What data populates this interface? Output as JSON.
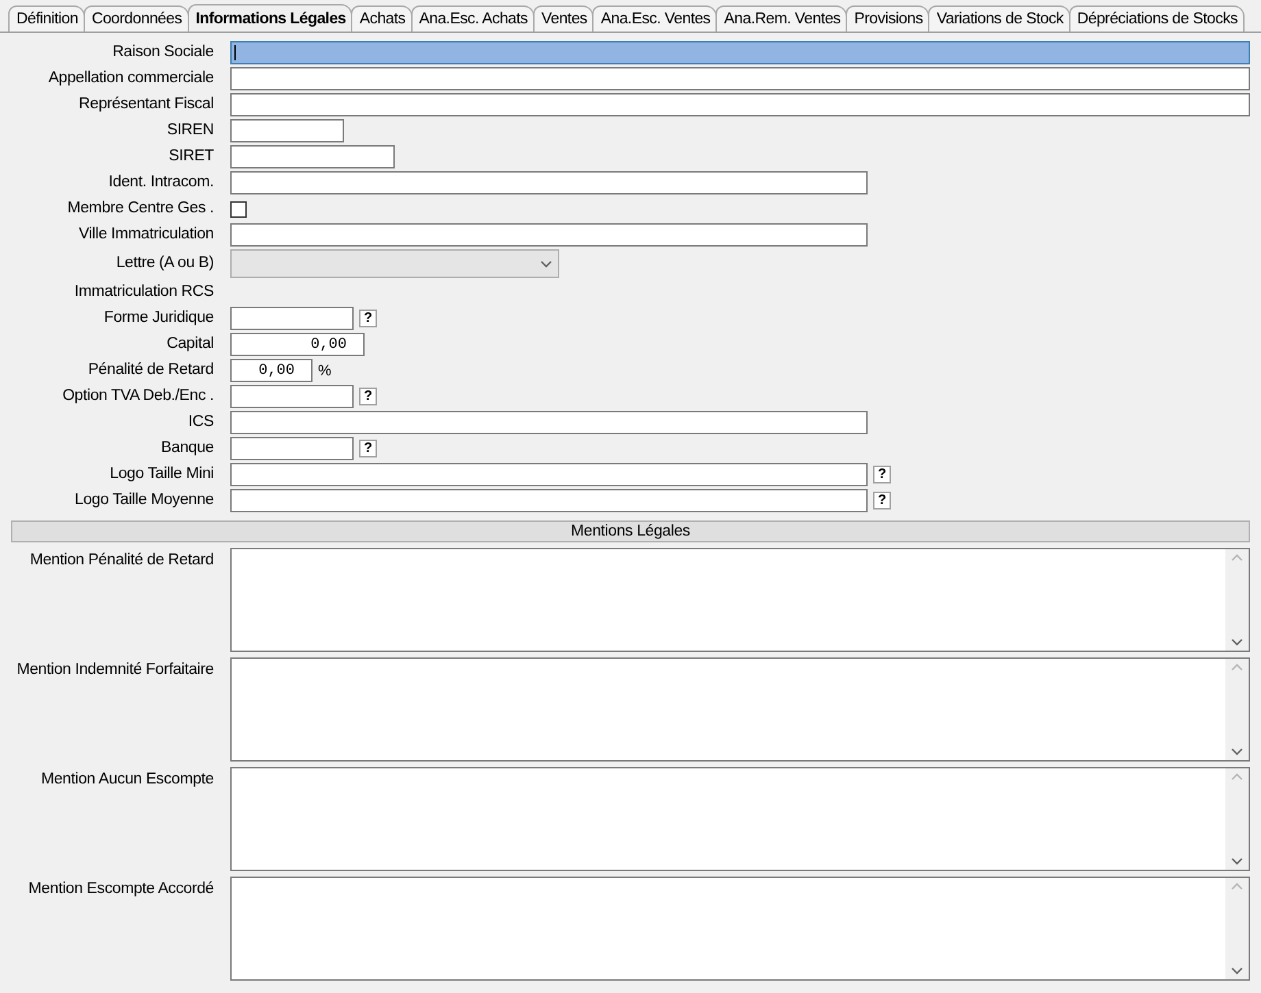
{
  "tabs": [
    {
      "label": "Définition",
      "selected": false
    },
    {
      "label": "Coordonnées",
      "selected": false
    },
    {
      "label": "Informations Légales",
      "selected": true
    },
    {
      "label": "Achats",
      "selected": false
    },
    {
      "label": "Ana.Esc. Achats",
      "selected": false
    },
    {
      "label": "Ventes",
      "selected": false
    },
    {
      "label": "Ana.Esc. Ventes",
      "selected": false
    },
    {
      "label": "Ana.Rem. Ventes",
      "selected": false
    },
    {
      "label": "Provisions",
      "selected": false
    },
    {
      "label": "Variations de Stock",
      "selected": false
    },
    {
      "label": "Dépréciations de Stocks",
      "selected": false
    }
  ],
  "fields": [
    {
      "kind": "text",
      "label": "Raison Sociale",
      "focused": true
    },
    {
      "kind": "text",
      "label": "Appellation commerciale",
      "focused": false
    },
    {
      "kind": "text",
      "label": "Représentant Fiscal",
      "focused": false
    },
    {
      "kind": "text",
      "label": "SIREN",
      "focused": false
    },
    {
      "kind": "text",
      "label": "SIRET",
      "focused": false
    },
    {
      "kind": "text",
      "label": "Ident. Intracom.",
      "focused": false
    },
    {
      "kind": "checkbox",
      "label": "Membre Centre Ges .",
      "checked": false
    },
    {
      "kind": "text",
      "label": "Ville Immatriculation",
      "focused": false
    },
    {
      "kind": "select",
      "label": "Lettre (A ou B)",
      "disabled": true
    },
    {
      "kind": "heading",
      "label": "Immatriculation RCS"
    },
    {
      "kind": "text",
      "label": "Forme Juridique",
      "focused": false,
      "help": "?"
    },
    {
      "kind": "number",
      "label": "Capital",
      "value": "0,00"
    },
    {
      "kind": "number",
      "label": "Pénalité de Retard",
      "value": "0,00",
      "suffix": "%"
    },
    {
      "kind": "text",
      "label": "Option TVA Deb./Enc .",
      "focused": false,
      "help": "?"
    },
    {
      "kind": "text",
      "label": "ICS",
      "focused": false
    },
    {
      "kind": "text",
      "label": "Banque",
      "focused": false,
      "help": "?"
    },
    {
      "kind": "text",
      "label": "Logo Taille Mini",
      "focused": false,
      "help": "?"
    },
    {
      "kind": "text",
      "label": "Logo Taille Moyenne",
      "focused": false,
      "help": "?"
    }
  ],
  "section": {
    "title": "Mentions Légales"
  },
  "mentions": [
    {
      "label": "Mention Pénalité de Retard"
    },
    {
      "label": "Mention Indemnité Forfaitaire"
    },
    {
      "label": "Mention Aucun Escompte"
    },
    {
      "label": "Mention Escompte Accordé"
    }
  ]
}
